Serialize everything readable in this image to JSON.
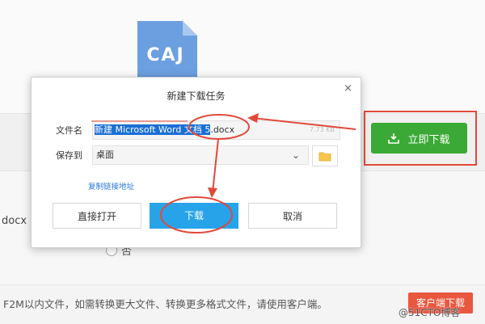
{
  "background": {
    "caj_icon_label": "CAJ",
    "partial_filename": "docx",
    "radio_label": "否",
    "notice_text": "F2M以内文件，如需转换更大文件、转换更多格式文件，请使用客户端。",
    "client_button_label": "客户端下载",
    "instant_download_label": "立即下载",
    "watermark": "@51CTO博客"
  },
  "dialog": {
    "title": "新建下载任务",
    "close_label": "×",
    "filename_label": "文件名",
    "filename_selected": "新建 Microsoft Word 文档 5",
    "filename_ext": ".docx",
    "filename_size": "7.73 KB",
    "saveto_label": "保存到",
    "saveto_value": "桌面",
    "copy_link_label": "复制链接地址",
    "buttons": {
      "open_directly": "直接打开",
      "download": "下载",
      "cancel": "取消"
    }
  },
  "colors": {
    "green_button": "#3aa935",
    "blue_button": "#27a3ea",
    "annotation_red": "#e04a3a",
    "selection_blue": "#1a6fd6"
  },
  "icons": [
    "document-icon",
    "download-icon",
    "folder-icon",
    "close-icon",
    "chevron-down-icon"
  ]
}
